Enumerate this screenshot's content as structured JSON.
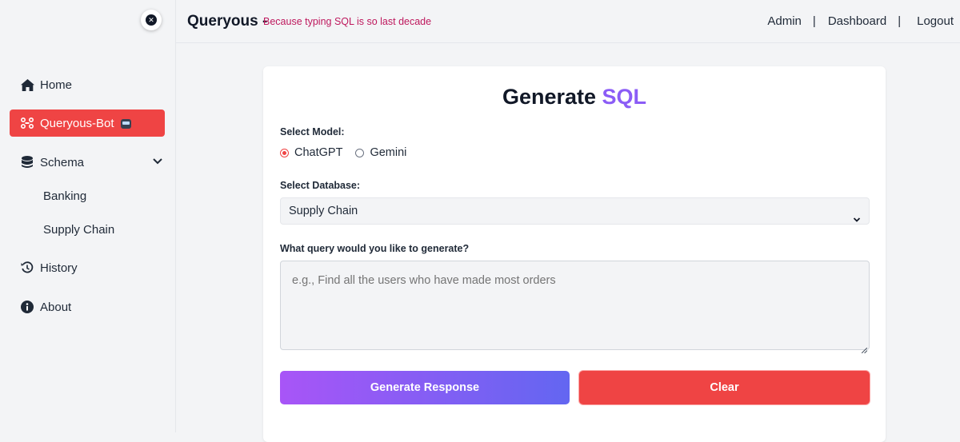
{
  "header": {
    "brand": "Queryous -",
    "tagline": "Because typing SQL is so last decade",
    "nav": {
      "admin": "Admin",
      "separator": "|",
      "dashboard": "Dashboard",
      "logout": "Logout"
    }
  },
  "sidebar": {
    "items": {
      "home": "Home",
      "bot": "Queryous-Bot",
      "schema": "Schema",
      "history": "History",
      "about": "About"
    },
    "schema_children": [
      "Banking",
      "Supply Chain"
    ]
  },
  "card": {
    "title_main": "Generate",
    "title_accent": "SQL",
    "model_label": "Select Model:",
    "models": [
      {
        "label": "ChatGPT",
        "checked": true
      },
      {
        "label": "Gemini",
        "checked": false
      }
    ],
    "database_label": "Select Database:",
    "database_selected": "Supply Chain",
    "query_label": "What query would you like to generate?",
    "query_placeholder": "e.g., Find all the users who have made most orders",
    "query_value": "",
    "generate_label": "Generate Response",
    "clear_label": "Clear"
  },
  "colors": {
    "active_nav": "#ef4444",
    "accent": "#8b5cf6",
    "tagline": "#be185d",
    "generate_gradient_start": "#a855f7",
    "generate_gradient_end": "#6366f1",
    "clear": "#ef4444"
  },
  "icons": {
    "close": "close-icon",
    "home": "home-icon",
    "bot": "bot-icon",
    "schema": "database-icon",
    "schema_toggle": "chevron-down-icon",
    "history": "history-icon",
    "about": "info-icon",
    "select_toggle": "chevron-down-icon"
  }
}
